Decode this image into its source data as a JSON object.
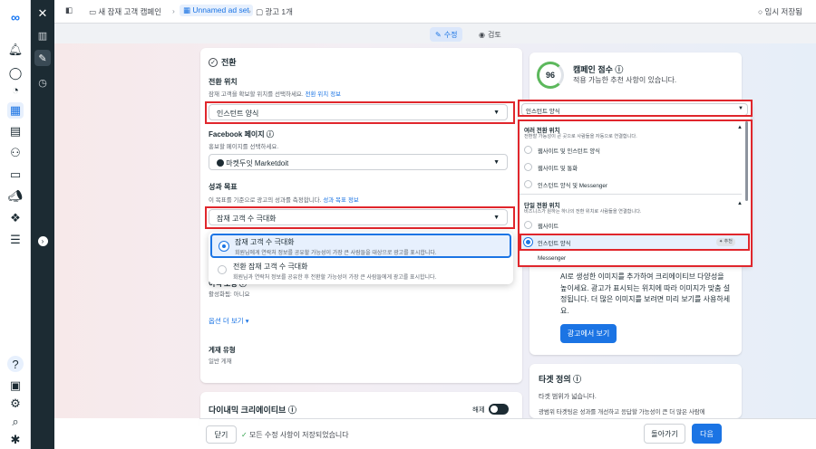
{
  "topbar": {
    "crumb_campaign": "새 잠재 고객 캠페인",
    "crumb_adset": "Unnamed ad set",
    "crumb_ad": "광고 1개",
    "save_status": "임시 저장됨"
  },
  "modes": {
    "edit": "수정",
    "review": "검토"
  },
  "conversion": {
    "section_title": "전환",
    "location": {
      "label": "전환 위치",
      "help": "잠재 고객을 확보할 위치를 선택하세요.",
      "help_link": "전환 위치 정보",
      "value": "인스턴트 양식"
    },
    "facebook_page": {
      "label": "Facebook 페이지",
      "help": "홍보할 페이지를 선택하세요.",
      "value": "마켓두잇 Marketdoit"
    },
    "goal": {
      "label": "성과 목표",
      "help": "이 목표를 기준으로 광고의 성과를 측정합니다.",
      "help_link": "성과 목표 정보",
      "value": "잠재 고객 수 극대화"
    },
    "partial_label": "이익 보정",
    "partial_value": "활성화됨: 아니요",
    "more_options": "옵션 더 보기",
    "account_type_label": "게재 유형",
    "account_type_value": "일반 게재"
  },
  "goal_dropdown": {
    "options": [
      {
        "title": "잠재 고객 수 극대화",
        "desc": "회원님에게 연락처 정보를 공유할 가능성이 가장 큰 사람들을 대상으로 광고를 표시합니다.",
        "selected": true
      },
      {
        "title": "전환 잠재 고객 수 극대화",
        "desc": "회원님과 연락처 정보를 공유한 후 전환할 가능성이 가장 큰 사람들에게 광고를 표시합니다.",
        "selected": false
      }
    ]
  },
  "dynamic_creative": {
    "label": "다이내믹 크리에이티브",
    "toggle_label": "해제"
  },
  "campaign_score": {
    "score": "96",
    "title": "캠페인 점수",
    "subtitle": "적용 가능한 추천 사항이 있습니다."
  },
  "location_dropdown": {
    "value": "인스턴트 양식",
    "group1_title": "여러 전환 위치",
    "group1_desc": "전환할 가능성이 큰 곳으로 사람들을 자동으로 연결합니다.",
    "group1_items": [
      "웹사이트 및 인스턴트 양식",
      "웹사이트 및 통화",
      "인스턴트 양식 및 Messenger"
    ],
    "group2_title": "단일 전환 위치",
    "group2_desc": "비즈니스가 원하는 하나의 전환 위치로 사람들을 연결합니다.",
    "group2_items": [
      "웹사이트",
      "인스턴트 양식",
      "Messenger"
    ],
    "recommended_badge": "추천"
  },
  "ai_card": {
    "text": "AI로 생성한 이미지를 추가하여 크리에이티브 다양성을 높이세요. 광고가 표시되는 위치에 따라 이미지가 맞춤 설정됩니다. 더 많은 이미지를 보려면 미리 보기를 사용하세요.",
    "button": "광고에서 보기"
  },
  "target": {
    "title": "타겟 정의",
    "line1": "타겟 범위가 넓습니다.",
    "line2": "광범위 타겟팅은 성과를 개선하고 응답할 가능성이 큰 더 많은 사람에"
  },
  "bottombar": {
    "close": "닫기",
    "saved": "모든 수정 사항이 저장되었습니다",
    "back": "돌아가기",
    "next": "다음"
  },
  "colors": {
    "accent": "#1b74e4",
    "highlight_border": "#e0262c",
    "dark_sidebar": "#1c2b33"
  }
}
